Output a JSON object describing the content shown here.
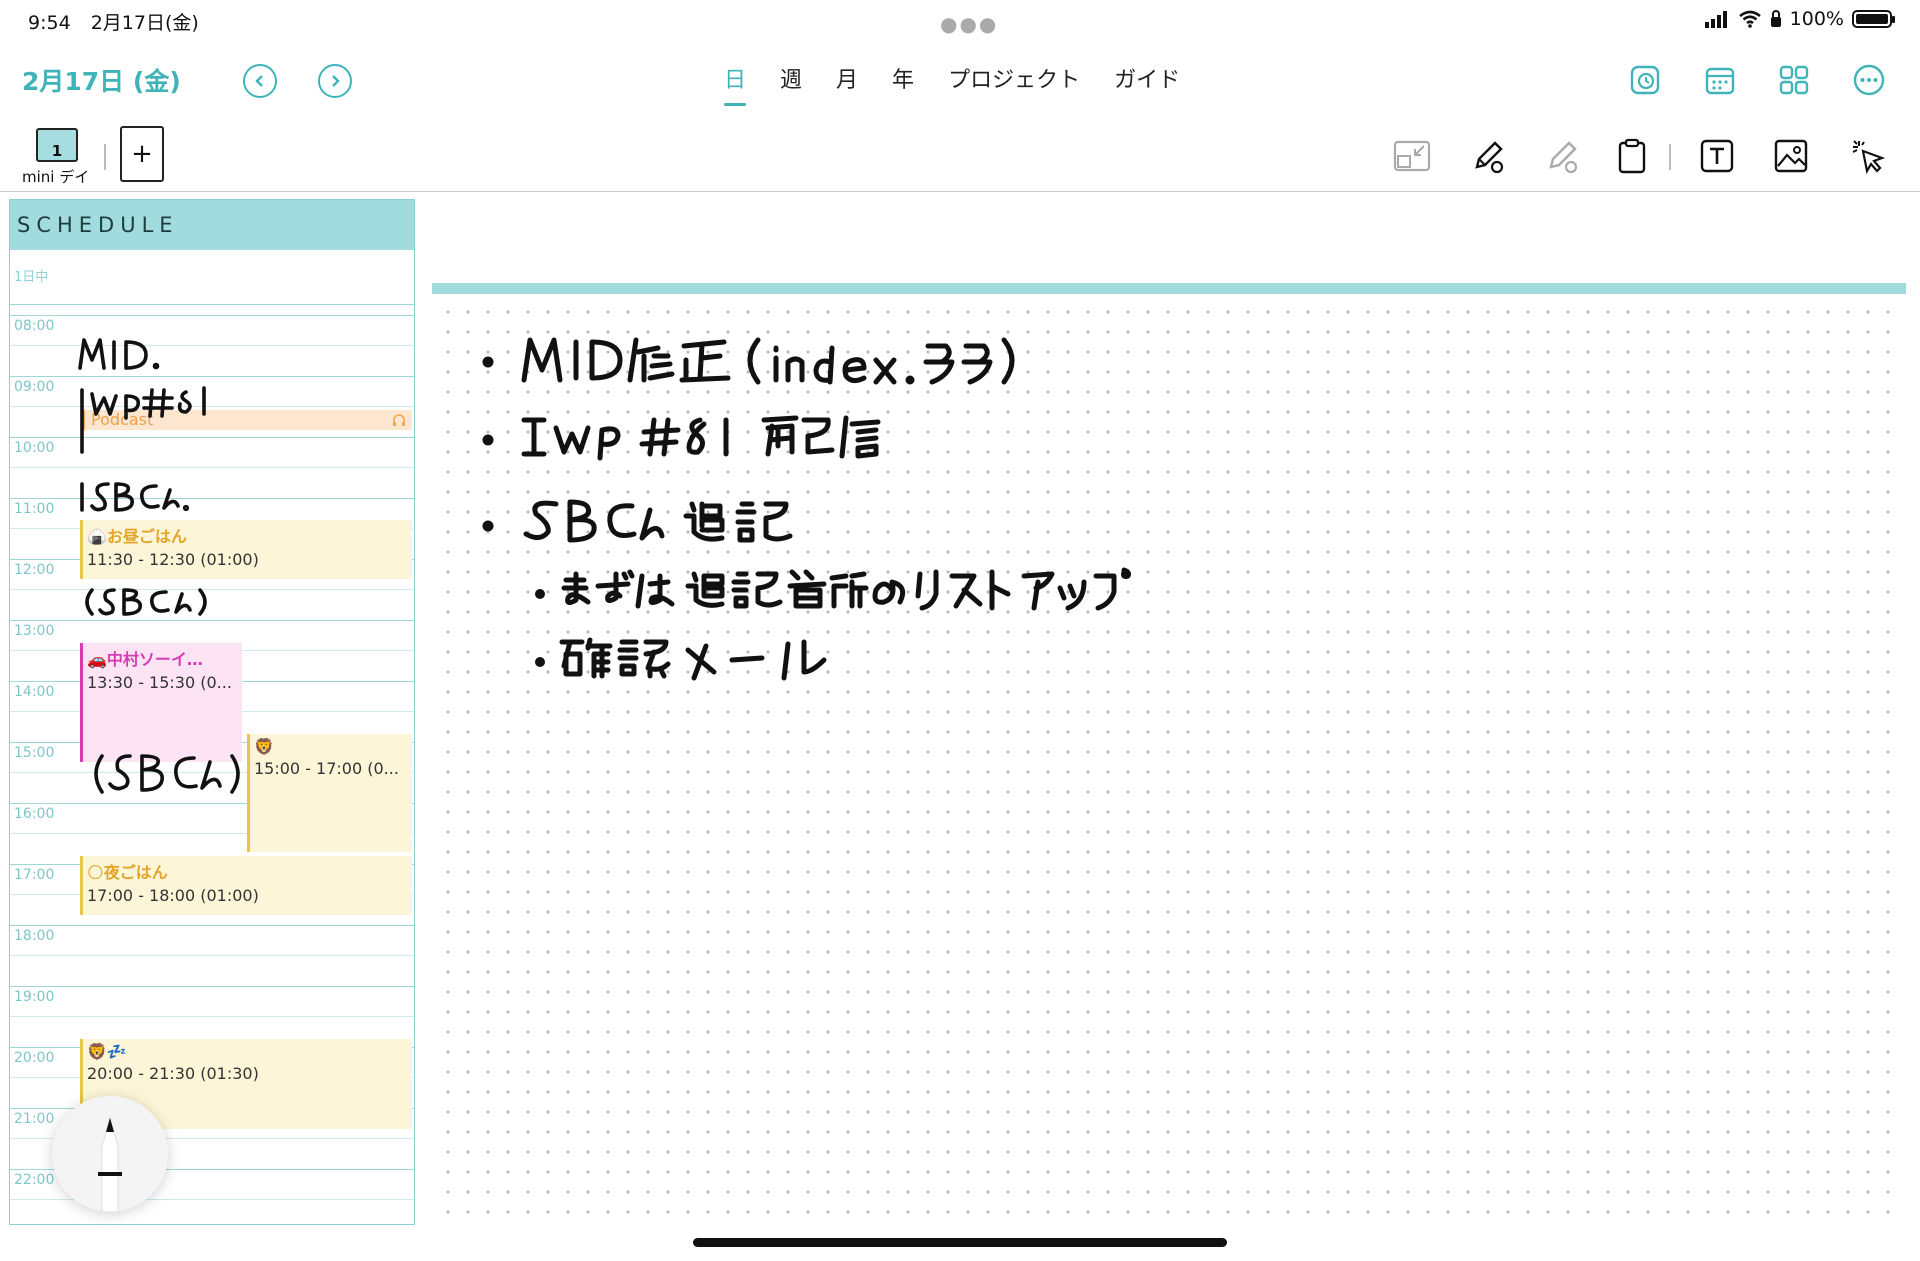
{
  "status_bar": {
    "time": "9:54",
    "date": "2月17日(金)",
    "battery": "100%",
    "battery_level": 1.0
  },
  "nav": {
    "date_title": "2月17日 (金)",
    "tabs": [
      "日",
      "週",
      "月",
      "年",
      "プロジェクト",
      "ガイド"
    ],
    "active_tab": "日"
  },
  "toolbar": {
    "page_number": "1",
    "page_label": "mini デイ",
    "add_page": "+"
  },
  "schedule": {
    "header": "SCHEDULE",
    "allday_label": "1日中",
    "hours": [
      "08:00",
      "09:00",
      "10:00",
      "11:00",
      "12:00",
      "13:00",
      "14:00",
      "15:00",
      "16:00",
      "17:00",
      "18:00",
      "19:00",
      "20:00",
      "21:00",
      "22:00"
    ],
    "events": [
      {
        "title": "Podcast",
        "icon": "headphones-icon",
        "color": "#f3a54e"
      },
      {
        "emoji": "🍙",
        "title": "お昼ごはん",
        "time": "11:30 - 12:30 (01:00)",
        "color": "#e8c44a"
      },
      {
        "emoji": "🚗",
        "title": "中村ソーイ…",
        "time": "13:30 - 15:30 (0...",
        "color": "#d63bb3"
      },
      {
        "emoji": "🦁",
        "title": "",
        "time": "15:00 - 17:00 (0...",
        "color": "#e8c44a"
      },
      {
        "emoji": "🌕",
        "title": "夜ごはん",
        "time": "17:00 - 18:00 (01:00)",
        "color": "#e8c44a"
      },
      {
        "emoji": "🦁💤",
        "title": "",
        "time": "20:00 - 21:30 (01:30)",
        "color": "#e8c44a"
      }
    ],
    "handwritten": [
      "MID.",
      "IWP#81",
      "SBCん",
      "(SBCん)",
      "(SBCん)"
    ]
  },
  "note": {
    "handwritten_lines": [
      "• MID修正 (index.ララ)",
      "• IWP #81 配信",
      "• SBCん追記",
      "• まずは追記箇所のリストアップ",
      "• 確認メール"
    ]
  },
  "colors": {
    "accent": "#3fb4b8",
    "schedule_header": "#a2dbde",
    "event_yellow": "#fdf5d7",
    "event_pink": "#fce4f5",
    "event_orange": "#fde6cf"
  }
}
